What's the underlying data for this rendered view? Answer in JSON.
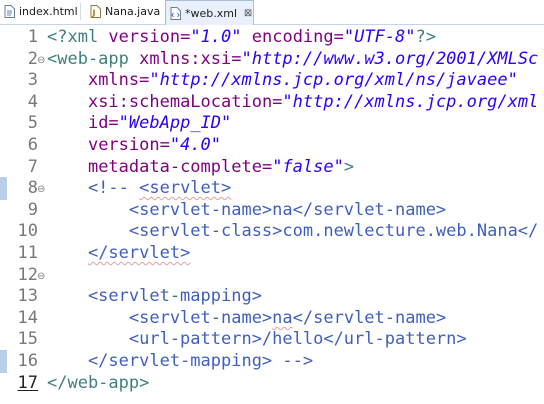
{
  "tabs": [
    {
      "label": "index.html",
      "icon": "html-file-icon",
      "active": false
    },
    {
      "label": "Nana.java",
      "icon": "java-file-icon",
      "active": false
    },
    {
      "label": "*web.xml",
      "icon": "xml-file-icon",
      "active": true,
      "close": "⊠"
    }
  ],
  "colors": {
    "tag": "#3f7f7f",
    "attribute": "#7f007f",
    "value": "#2a00ff",
    "comment": "#3f5fbf",
    "gutter_highlight": "#b8cfe8"
  },
  "editor": {
    "lines": [
      {
        "n": "1",
        "tokens": [
          [
            "decl",
            "<?xml "
          ],
          [
            "attr",
            "version="
          ],
          [
            "val",
            "\"1.0\""
          ],
          [
            "text",
            " "
          ],
          [
            "attr",
            "encoding="
          ],
          [
            "val",
            "\"UTF-8\""
          ],
          [
            "decl",
            "?>"
          ]
        ]
      },
      {
        "n": "2",
        "fold": "⊖",
        "tokens": [
          [
            "tag",
            "<web-app "
          ],
          [
            "attr",
            "xmlns:xsi="
          ],
          [
            "val",
            "\"http://www.w3.org/2001/XMLSc"
          ]
        ]
      },
      {
        "n": "3",
        "tokens": [
          [
            "text",
            "    "
          ],
          [
            "attr",
            "xmlns="
          ],
          [
            "val",
            "\"http://xmlns.jcp.org/xml/ns/javaee\""
          ]
        ]
      },
      {
        "n": "4",
        "tokens": [
          [
            "text",
            "    "
          ],
          [
            "attr",
            "xsi:schemaLocation="
          ],
          [
            "val",
            "\"http://xmlns.jcp.org/xml"
          ]
        ]
      },
      {
        "n": "5",
        "tokens": [
          [
            "text",
            "    "
          ],
          [
            "attr",
            "id="
          ],
          [
            "val",
            "\"WebApp_ID\""
          ]
        ]
      },
      {
        "n": "6",
        "tokens": [
          [
            "text",
            "    "
          ],
          [
            "attr",
            "version="
          ],
          [
            "val",
            "\"4.0\""
          ]
        ]
      },
      {
        "n": "7",
        "tokens": [
          [
            "text",
            "    "
          ],
          [
            "attr",
            "metadata-complete="
          ],
          [
            "val",
            "\"false\""
          ],
          [
            "tag",
            ">"
          ]
        ]
      },
      {
        "n": "8",
        "fold": "⊖",
        "mark": true,
        "tokens": [
          [
            "comment",
            "    <!-- "
          ],
          [
            "csq",
            "<servlet>"
          ]
        ]
      },
      {
        "n": "9",
        "tokens": [
          [
            "comment",
            "        <servlet-name>na</servlet-name>"
          ]
        ]
      },
      {
        "n": "10",
        "tokens": [
          [
            "comment",
            "        <servlet-class>com.newlecture.web.Nana</"
          ]
        ]
      },
      {
        "n": "11",
        "tokens": [
          [
            "comment",
            "    "
          ],
          [
            "csq",
            "</servlet>"
          ]
        ]
      },
      {
        "n": "12",
        "fold": "⊖",
        "tokens": []
      },
      {
        "n": "13",
        "tokens": [
          [
            "comment",
            "    <servlet-mapping>"
          ]
        ]
      },
      {
        "n": "14",
        "tokens": [
          [
            "comment",
            "        <servlet-name>"
          ],
          [
            "csq",
            "na"
          ],
          [
            "comment",
            "</servlet-name>"
          ]
        ]
      },
      {
        "n": "15",
        "tokens": [
          [
            "comment",
            "        <url-pattern>/hello</url-pattern>"
          ]
        ]
      },
      {
        "n": "16",
        "mark": true,
        "tokens": [
          [
            "comment",
            "    </servlet-mapping> -->"
          ]
        ]
      },
      {
        "n": "17",
        "current": true,
        "tokens": [
          [
            "tag",
            "</web-app>"
          ]
        ]
      }
    ]
  }
}
